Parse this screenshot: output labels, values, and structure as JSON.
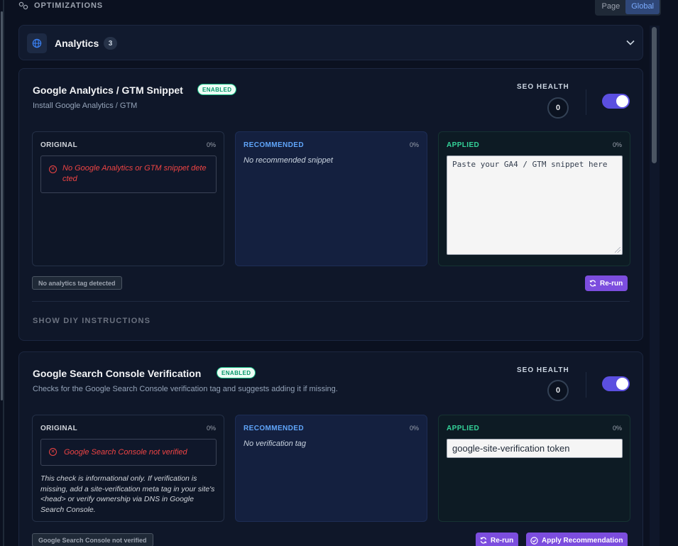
{
  "header": {
    "title": "OPTIMIZATIONS",
    "scope_options": [
      "Page",
      "Global"
    ],
    "active_scope": "Global"
  },
  "group": {
    "label": "Analytics",
    "count": "3"
  },
  "cards": [
    {
      "title": "Google Analytics / GTM Snippet",
      "badge": "ENABLED",
      "subtitle": "Install Google Analytics / GTM",
      "health_label": "SEO HEALTH",
      "health_score": "0",
      "toggle_on": true,
      "original": {
        "label": "ORIGINAL",
        "pct": "0%",
        "message": "No Google Analytics or GTM snippet detected"
      },
      "recommended": {
        "label": "RECOMMENDED",
        "pct": "0%",
        "note": "No recommended snippet"
      },
      "applied": {
        "label": "APPLIED",
        "pct": "0%",
        "placeholder": "Paste your GA4 / GTM snippet here"
      },
      "status": "No analytics tag detected",
      "rerun_label": "Re-run",
      "diy_label": "SHOW DIY INSTRUCTIONS"
    },
    {
      "title": "Google Search Console Verification",
      "badge": "ENABLED",
      "subtitle": "Checks for the Google Search Console verification tag and suggests adding it if missing.",
      "health_label": "SEO HEALTH",
      "health_score": "0",
      "toggle_on": true,
      "original": {
        "label": "ORIGINAL",
        "pct": "0%",
        "message": "Google Search Console not verified",
        "info": "This check is informational only. If verification is missing, add a site-verification meta tag in your site's <head> or verify ownership via DNS in Google Search Console."
      },
      "recommended": {
        "label": "RECOMMENDED",
        "pct": "0%",
        "note": "No verification tag"
      },
      "applied": {
        "label": "APPLIED",
        "pct": "0%",
        "value": "google-site-verification token"
      },
      "status": "Google Search Console not verified",
      "rerun_label": "Re-run",
      "apply_label": "Apply Recommendation"
    }
  ],
  "colors": {
    "background": "#0b1120",
    "toggle": "#5b4fe0",
    "button": "#7c4dde",
    "recommended_accent": "#60a5fa",
    "applied_accent": "#34d399",
    "error": "#ef4444",
    "badge_green": "#059669"
  }
}
